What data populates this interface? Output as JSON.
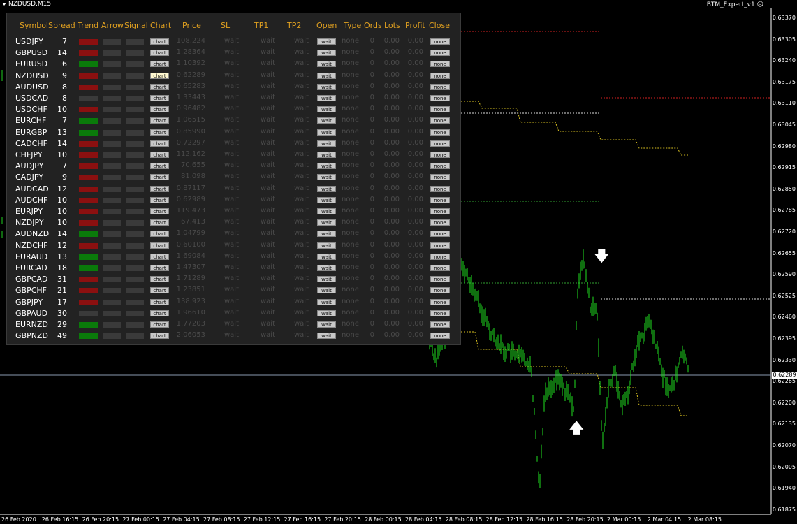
{
  "window": {
    "title": "NZDUSD,M15",
    "expert": "BTM_Expert_v1",
    "smiley": "☹"
  },
  "y_axis": {
    "labels": [
      "0.63370",
      "0.63305",
      "0.63240",
      "0.63175",
      "0.63110",
      "0.63045",
      "0.62980",
      "0.62915",
      "0.62850",
      "0.62785",
      "0.62720",
      "0.62655",
      "0.62590",
      "0.62525",
      "0.62460",
      "0.62395",
      "0.62330",
      "0.62265",
      "0.62200",
      "0.62135",
      "0.62070",
      "0.62005",
      "0.61940",
      "0.61875"
    ],
    "current_price": "0.62289"
  },
  "x_axis": {
    "labels": [
      "26 Feb 2020",
      "26 Feb 16:15",
      "26 Feb 20:15",
      "27 Feb 00:15",
      "27 Feb 04:15",
      "27 Feb 08:15",
      "27 Feb 12:15",
      "27 Feb 16:15",
      "27 Feb 20:15",
      "28 Feb 00:15",
      "28 Feb 04:15",
      "28 Feb 08:15",
      "28 Feb 12:15",
      "28 Feb 16:15",
      "28 Feb 20:15",
      "2 Mar 00:15",
      "2 Mar 04:15",
      "2 Mar 08:15"
    ]
  },
  "panel": {
    "headers": {
      "symbol": "Symbol",
      "spread": "Spread",
      "trend": "Trend",
      "arrow": "Arrow",
      "signal": "Signal",
      "chart": "Chart",
      "price": "Price",
      "sl": "SL",
      "tp1": "TP1",
      "tp2": "TP2",
      "open": "Open",
      "type": "Type",
      "ords": "Ords",
      "lots": "Lots",
      "profit": "Profit",
      "close": "Close"
    },
    "colors": {
      "red": "#8b1010",
      "green": "#0a7a0a",
      "gray": "#3a3a3a"
    },
    "rows": [
      {
        "symbol": "USDJPY",
        "spread": "7",
        "trend": "red",
        "chart": "chart",
        "price": "108.224",
        "sl": "wait",
        "tp1": "wait",
        "tp2": "wait",
        "open": "wait",
        "type": "none",
        "ords": "0",
        "lots": "0.00",
        "profit": "0.00",
        "close": "none"
      },
      {
        "symbol": "GBPUSD",
        "spread": "14",
        "trend": "red",
        "chart": "chart",
        "price": "1.28364",
        "sl": "wait",
        "tp1": "wait",
        "tp2": "wait",
        "open": "wait",
        "type": "none",
        "ords": "0",
        "lots": "0.00",
        "profit": "0.00",
        "close": "none"
      },
      {
        "symbol": "EURUSD",
        "spread": "6",
        "trend": "green",
        "chart": "chart",
        "price": "1.10392",
        "sl": "wait",
        "tp1": "wait",
        "tp2": "wait",
        "open": "wait",
        "type": "none",
        "ords": "0",
        "lots": "0.00",
        "profit": "0.00",
        "close": "none"
      },
      {
        "symbol": "NZDUSD",
        "spread": "9",
        "trend": "red",
        "chart": "chart",
        "active": true,
        "price": "0.62289",
        "sl": "wait",
        "tp1": "wait",
        "tp2": "wait",
        "open": "wait",
        "type": "none",
        "ords": "0",
        "lots": "0.00",
        "profit": "0.00",
        "close": "none"
      },
      {
        "symbol": "AUDUSD",
        "spread": "8",
        "trend": "red",
        "chart": "chart",
        "price": "0.65283",
        "sl": "wait",
        "tp1": "wait",
        "tp2": "wait",
        "open": "wait",
        "type": "none",
        "ords": "0",
        "lots": "0.00",
        "profit": "0.00",
        "close": "none"
      },
      {
        "symbol": "USDCAD",
        "spread": "8",
        "trend": "gray",
        "chart": "chart",
        "price": "1.33443",
        "sl": "wait",
        "tp1": "wait",
        "tp2": "wait",
        "open": "wait",
        "type": "none",
        "ords": "0",
        "lots": "0.00",
        "profit": "0.00",
        "close": "none"
      },
      {
        "symbol": "USDCHF",
        "spread": "10",
        "trend": "red",
        "chart": "chart",
        "price": "0.96482",
        "sl": "wait",
        "tp1": "wait",
        "tp2": "wait",
        "open": "wait",
        "type": "none",
        "ords": "0",
        "lots": "0.00",
        "profit": "0.00",
        "close": "none"
      },
      {
        "symbol": "EURCHF",
        "spread": "7",
        "trend": "green",
        "chart": "chart",
        "price": "1.06515",
        "sl": "wait",
        "tp1": "wait",
        "tp2": "wait",
        "open": "wait",
        "type": "none",
        "ords": "0",
        "lots": "0.00",
        "profit": "0.00",
        "close": "none"
      },
      {
        "symbol": "EURGBP",
        "spread": "13",
        "trend": "green",
        "chart": "chart",
        "price": "0.85990",
        "sl": "wait",
        "tp1": "wait",
        "tp2": "wait",
        "open": "wait",
        "type": "none",
        "ords": "0",
        "lots": "0.00",
        "profit": "0.00",
        "close": "none"
      },
      {
        "symbol": "CADCHF",
        "spread": "14",
        "trend": "red",
        "chart": "chart",
        "price": "0.72297",
        "sl": "wait",
        "tp1": "wait",
        "tp2": "wait",
        "open": "wait",
        "type": "none",
        "ords": "0",
        "lots": "0.00",
        "profit": "0.00",
        "close": "none"
      },
      {
        "symbol": "CHFJPY",
        "spread": "10",
        "trend": "red",
        "chart": "chart",
        "price": "112.162",
        "sl": "wait",
        "tp1": "wait",
        "tp2": "wait",
        "open": "wait",
        "type": "none",
        "ords": "0",
        "lots": "0.00",
        "profit": "0.00",
        "close": "none"
      },
      {
        "symbol": "AUDJPY",
        "spread": "7",
        "trend": "red",
        "chart": "chart",
        "price": "70.655",
        "sl": "wait",
        "tp1": "wait",
        "tp2": "wait",
        "open": "wait",
        "type": "none",
        "ords": "0",
        "lots": "0.00",
        "profit": "0.00",
        "close": "none"
      },
      {
        "symbol": "CADJPY",
        "spread": "9",
        "trend": "red",
        "chart": "chart",
        "price": "81.098",
        "sl": "wait",
        "tp1": "wait",
        "tp2": "wait",
        "open": "wait",
        "type": "none",
        "ords": "0",
        "lots": "0.00",
        "profit": "0.00",
        "close": "none"
      },
      {
        "symbol": "AUDCAD",
        "spread": "12",
        "trend": "red",
        "chart": "chart",
        "price": "0.87117",
        "sl": "wait",
        "tp1": "wait",
        "tp2": "wait",
        "open": "wait",
        "type": "none",
        "ords": "0",
        "lots": "0.00",
        "profit": "0.00",
        "close": "none"
      },
      {
        "symbol": "AUDCHF",
        "spread": "10",
        "trend": "red",
        "chart": "chart",
        "price": "0.62989",
        "sl": "wait",
        "tp1": "wait",
        "tp2": "wait",
        "open": "wait",
        "type": "none",
        "ords": "0",
        "lots": "0.00",
        "profit": "0.00",
        "close": "none"
      },
      {
        "symbol": "EURJPY",
        "spread": "10",
        "trend": "red",
        "chart": "chart",
        "price": "119.473",
        "sl": "wait",
        "tp1": "wait",
        "tp2": "wait",
        "open": "wait",
        "type": "none",
        "ords": "0",
        "lots": "0.00",
        "profit": "0.00",
        "close": "none"
      },
      {
        "symbol": "NZDJPY",
        "spread": "10",
        "trend": "red",
        "chart": "chart",
        "price": "67.413",
        "sl": "wait",
        "tp1": "wait",
        "tp2": "wait",
        "open": "wait",
        "type": "none",
        "ords": "0",
        "lots": "0.00",
        "profit": "0.00",
        "close": "none"
      },
      {
        "symbol": "AUDNZD",
        "spread": "14",
        "trend": "green",
        "chart": "chart",
        "price": "1.04799",
        "sl": "wait",
        "tp1": "wait",
        "tp2": "wait",
        "open": "wait",
        "type": "none",
        "ords": "0",
        "lots": "0.00",
        "profit": "0.00",
        "close": "none"
      },
      {
        "symbol": "NZDCHF",
        "spread": "12",
        "trend": "red",
        "chart": "chart",
        "price": "0.60100",
        "sl": "wait",
        "tp1": "wait",
        "tp2": "wait",
        "open": "wait",
        "type": "none",
        "ords": "0",
        "lots": "0.00",
        "profit": "0.00",
        "close": "none"
      },
      {
        "symbol": "EURAUD",
        "spread": "13",
        "trend": "green",
        "chart": "chart",
        "price": "1.69084",
        "sl": "wait",
        "tp1": "wait",
        "tp2": "wait",
        "open": "wait",
        "type": "none",
        "ords": "0",
        "lots": "0.00",
        "profit": "0.00",
        "close": "none"
      },
      {
        "symbol": "EURCAD",
        "spread": "18",
        "trend": "green",
        "chart": "chart",
        "price": "1.47307",
        "sl": "wait",
        "tp1": "wait",
        "tp2": "wait",
        "open": "wait",
        "type": "none",
        "ords": "0",
        "lots": "0.00",
        "profit": "0.00",
        "close": "none"
      },
      {
        "symbol": "GBPCAD",
        "spread": "31",
        "trend": "red",
        "chart": "chart",
        "price": "1.71289",
        "sl": "wait",
        "tp1": "wait",
        "tp2": "wait",
        "open": "wait",
        "type": "none",
        "ords": "0",
        "lots": "0.00",
        "profit": "0.00",
        "close": "none"
      },
      {
        "symbol": "GBPCHF",
        "spread": "21",
        "trend": "red",
        "chart": "chart",
        "price": "1.23851",
        "sl": "wait",
        "tp1": "wait",
        "tp2": "wait",
        "open": "wait",
        "type": "none",
        "ords": "0",
        "lots": "0.00",
        "profit": "0.00",
        "close": "none"
      },
      {
        "symbol": "GBPJPY",
        "spread": "17",
        "trend": "red",
        "chart": "chart",
        "price": "138.923",
        "sl": "wait",
        "tp1": "wait",
        "tp2": "wait",
        "open": "wait",
        "type": "none",
        "ords": "0",
        "lots": "0.00",
        "profit": "0.00",
        "close": "none"
      },
      {
        "symbol": "GBPAUD",
        "spread": "30",
        "trend": "gray",
        "chart": "chart",
        "price": "1.96610",
        "sl": "wait",
        "tp1": "wait",
        "tp2": "wait",
        "open": "wait",
        "type": "none",
        "ords": "0",
        "lots": "0.00",
        "profit": "0.00",
        "close": "none"
      },
      {
        "symbol": "EURNZD",
        "spread": "29",
        "trend": "green",
        "chart": "chart",
        "price": "1.77203",
        "sl": "wait",
        "tp1": "wait",
        "tp2": "wait",
        "open": "wait",
        "type": "none",
        "ords": "0",
        "lots": "0.00",
        "profit": "0.00",
        "close": "none"
      },
      {
        "symbol": "GBPNZD",
        "spread": "49",
        "trend": "green",
        "chart": "chart",
        "price": "2.06053",
        "sl": "wait",
        "tp1": "wait",
        "tp2": "wait",
        "open": "wait",
        "type": "none",
        "ords": "0",
        "lots": "0.00",
        "profit": "0.00",
        "close": "none"
      }
    ]
  },
  "markers": {
    "down_arrow": "down-arrow-icon",
    "up_arrow": "up-arrow-icon"
  }
}
